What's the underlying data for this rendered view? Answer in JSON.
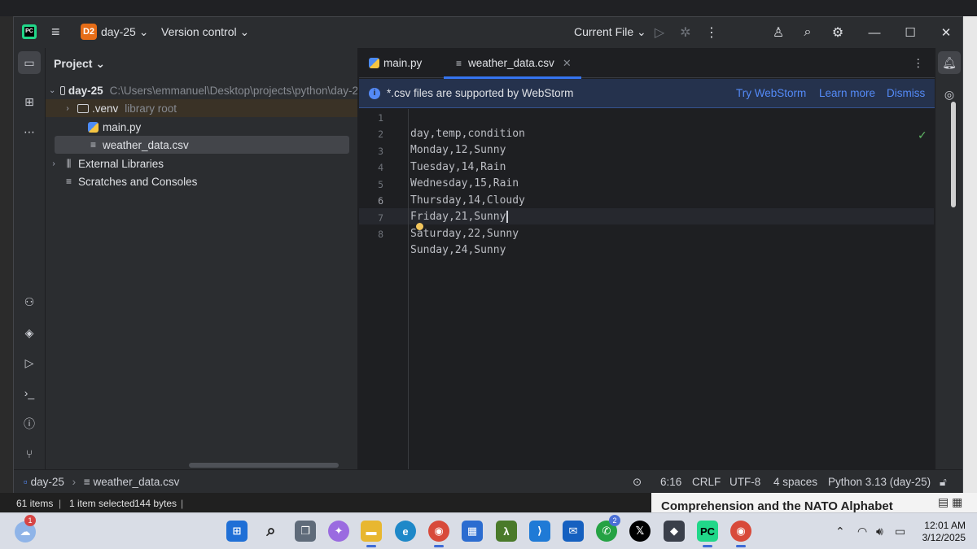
{
  "background_strip": "Comprehension and the NATO Alphabet",
  "titlebar": {
    "project_badge": "D2",
    "project_name": "day-25",
    "vcs": "Version control",
    "run_config": "Current File"
  },
  "project_panel": {
    "title": "Project",
    "tree": [
      {
        "label": "day-25",
        "hint": "C:\\Users\\emmanuel\\Desktop\\projects\\python\\day-2"
      },
      {
        "label": ".venv",
        "hint": "library root"
      },
      {
        "label": "main.py"
      },
      {
        "label": "weather_data.csv"
      },
      {
        "label": "External Libraries"
      },
      {
        "label": "Scratches and Consoles"
      }
    ]
  },
  "tabs": [
    {
      "label": "main.py"
    },
    {
      "label": "weather_data.csv"
    }
  ],
  "banner": {
    "message": "*.csv files are supported by WebStorm",
    "try": "Try WebStorm",
    "learn": "Learn more",
    "dismiss": "Dismiss"
  },
  "editor": {
    "line_numbers": [
      "1",
      "2",
      "3",
      "4",
      "5",
      "6",
      "7",
      "8"
    ],
    "lines": [
      "day,temp,condition",
      "Monday,12,Sunny",
      "Tuesday,14,Rain",
      "Wednesday,15,Rain",
      "Thursday,14,Cloudy",
      "Friday,21,Sunny",
      "Saturday,22,Sunny",
      "Sunday,24,Sunny"
    ],
    "current_line": 6
  },
  "statusbar": {
    "breadcrumb_project": "day-25",
    "breadcrumb_file": "weather_data.csv",
    "position": "6:16",
    "line_ending": "CRLF",
    "encoding": "UTF-8",
    "indent": "4 spaces",
    "interpreter": "Python 3.13 (day-25)"
  },
  "explorer": {
    "items": "61 items",
    "selected": "1 item selected",
    "size": "144 bytes"
  },
  "taskbar": {
    "weather_badge": "1",
    "whatsapp_badge": "2",
    "time": "12:01 AM",
    "date": "3/12/2025"
  },
  "colors": {
    "accent": "#3574f0",
    "panel": "#2b2d30",
    "editor": "#1e1f22",
    "badge": "#e66d17"
  }
}
